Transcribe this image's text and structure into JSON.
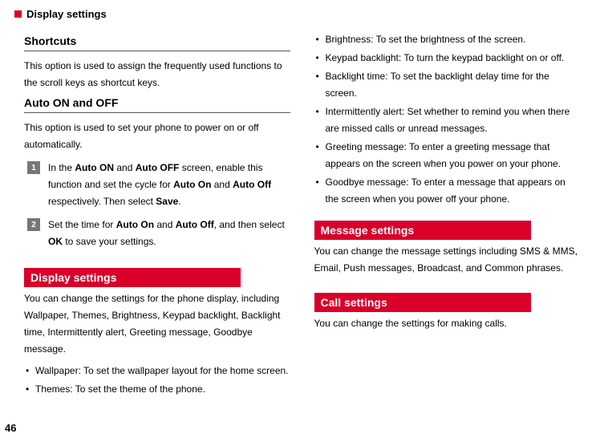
{
  "header": {
    "title": "Display settings"
  },
  "page_number": "46",
  "left": {
    "shortcuts": {
      "heading": "Shortcuts",
      "para": "This option is used to assign the frequently used functions to the scroll keys as shortcut keys."
    },
    "auto": {
      "heading": "Auto ON and OFF",
      "para": "This option is used to set your phone to power on or off automatically.",
      "step1": {
        "num": "1",
        "t1": "In the ",
        "b1": "Auto ON",
        "t2": " and ",
        "b2": "Auto OFF",
        "t3": " screen, enable this function and set the cycle for ",
        "b3": "Auto On",
        "t4": " and ",
        "b4": "Auto Off",
        "t5": " respectively. Then select ",
        "b5": "Save",
        "t6": "."
      },
      "step2": {
        "num": "2",
        "t1": "Set the time for ",
        "b1": "Auto On",
        "t2": " and ",
        "b2": "Auto Off",
        "t3": ", and then select ",
        "b3": "OK",
        "t4": " to save your settings."
      }
    },
    "display": {
      "bar": "Display settings",
      "para": "You can change the settings for the phone display, including Wallpaper, Themes, Brightness, Keypad backlight, Backlight time, Intermittently alert, Greeting message, Goodbye message.",
      "bullets": [
        "Wallpaper: To set the wallpaper layout for the home screen.",
        "Themes: To set the theme of the phone."
      ]
    }
  },
  "right": {
    "bullets": [
      "Brightness: To set the brightness of the screen.",
      "Keypad backlight: To turn the keypad backlight on or off.",
      "Backlight time: To set the backlight delay time for the screen.",
      "Intermittently alert: Set whether to remind you when there are missed calls or unread messages.",
      "Greeting message: To enter a greeting message that appears on the screen when you power on your phone.",
      "Goodbye message: To enter a message that appears on the screen when you power off your phone."
    ],
    "message": {
      "bar": "Message settings",
      "para": "You can change the message settings including SMS & MMS, Email, Push messages, Broadcast, and Common phrases."
    },
    "call": {
      "bar": "Call settings",
      "para": "You can change the settings for making calls."
    }
  }
}
